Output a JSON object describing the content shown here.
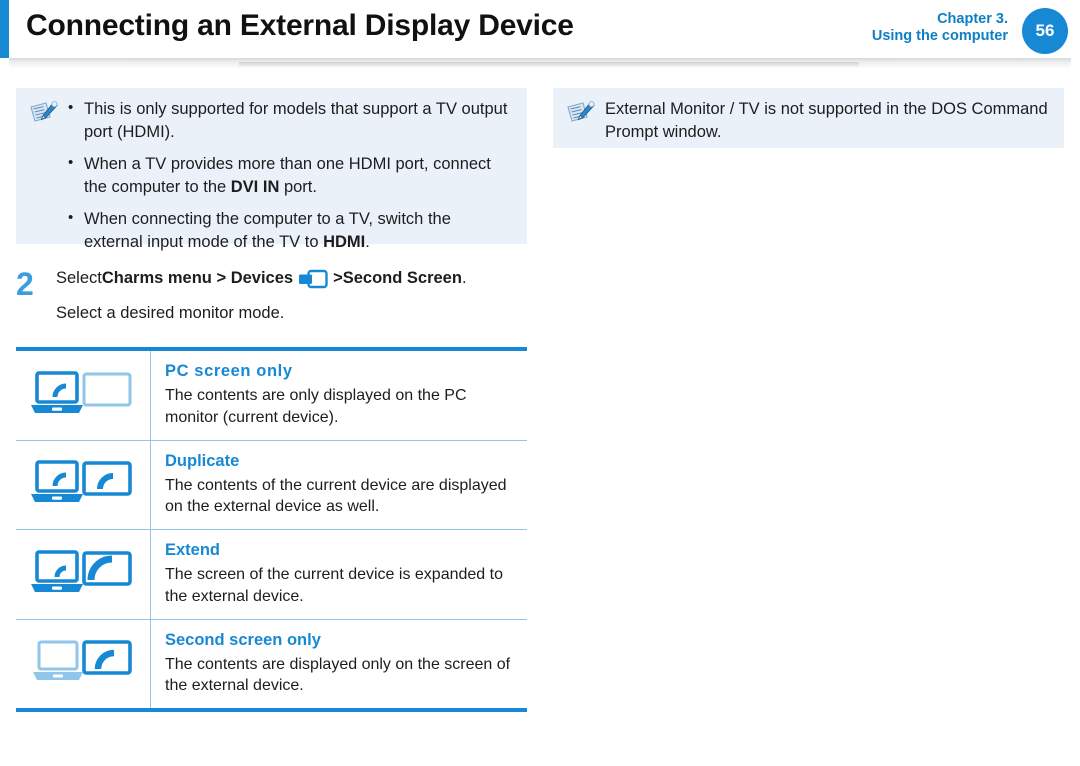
{
  "header": {
    "title": "Connecting an External Display Device",
    "chapter_line1": "Chapter 3.",
    "chapter_line2": "Using the computer",
    "page_number": "56",
    "accent_color": "#1789d4"
  },
  "notes": {
    "left": {
      "icon": "note-pen-icon",
      "items": [
        "This is only supported for models that support a TV output port (HDMI).",
        "When a TV provides more than one HDMI port, connect the computer to the DVI IN port.",
        "When connecting the computer to a TV, switch the external input mode of the TV to HDMI."
      ]
    },
    "right": {
      "icon": "note-pen-icon",
      "text": "External Monitor / TV is not supported in the DOS Command Prompt window."
    }
  },
  "step": {
    "number": "2",
    "line1_part1": "Select ",
    "line1_bold1": "Charms menu > Devices",
    "line1_icon": "devices-icon",
    "line1_part2": " > ",
    "line1_bold2": "Second Screen",
    "line1_part3": ".",
    "line2": "Select a desired monitor mode."
  },
  "mode_table": {
    "rows": [
      {
        "icon": "pc-screen-only-icon",
        "title": "PC screen only",
        "desc": "The contents are only displayed on the PC monitor (current device)."
      },
      {
        "icon": "duplicate-icon",
        "title": "Duplicate",
        "desc": "The contents of the current device are displayed on the external device as well."
      },
      {
        "icon": "extend-icon",
        "title": "Extend",
        "desc": "The screen of the current device is expanded to the external device."
      },
      {
        "icon": "second-screen-only-icon",
        "title": "Second screen only",
        "desc": "The contents are displayed only on the screen of the external device."
      }
    ]
  },
  "colors": {
    "brand_blue": "#1789d4",
    "light_blue": "#8fc6ea",
    "note_bg": "#eaf1f9",
    "step_number": "#3b9ddd"
  }
}
